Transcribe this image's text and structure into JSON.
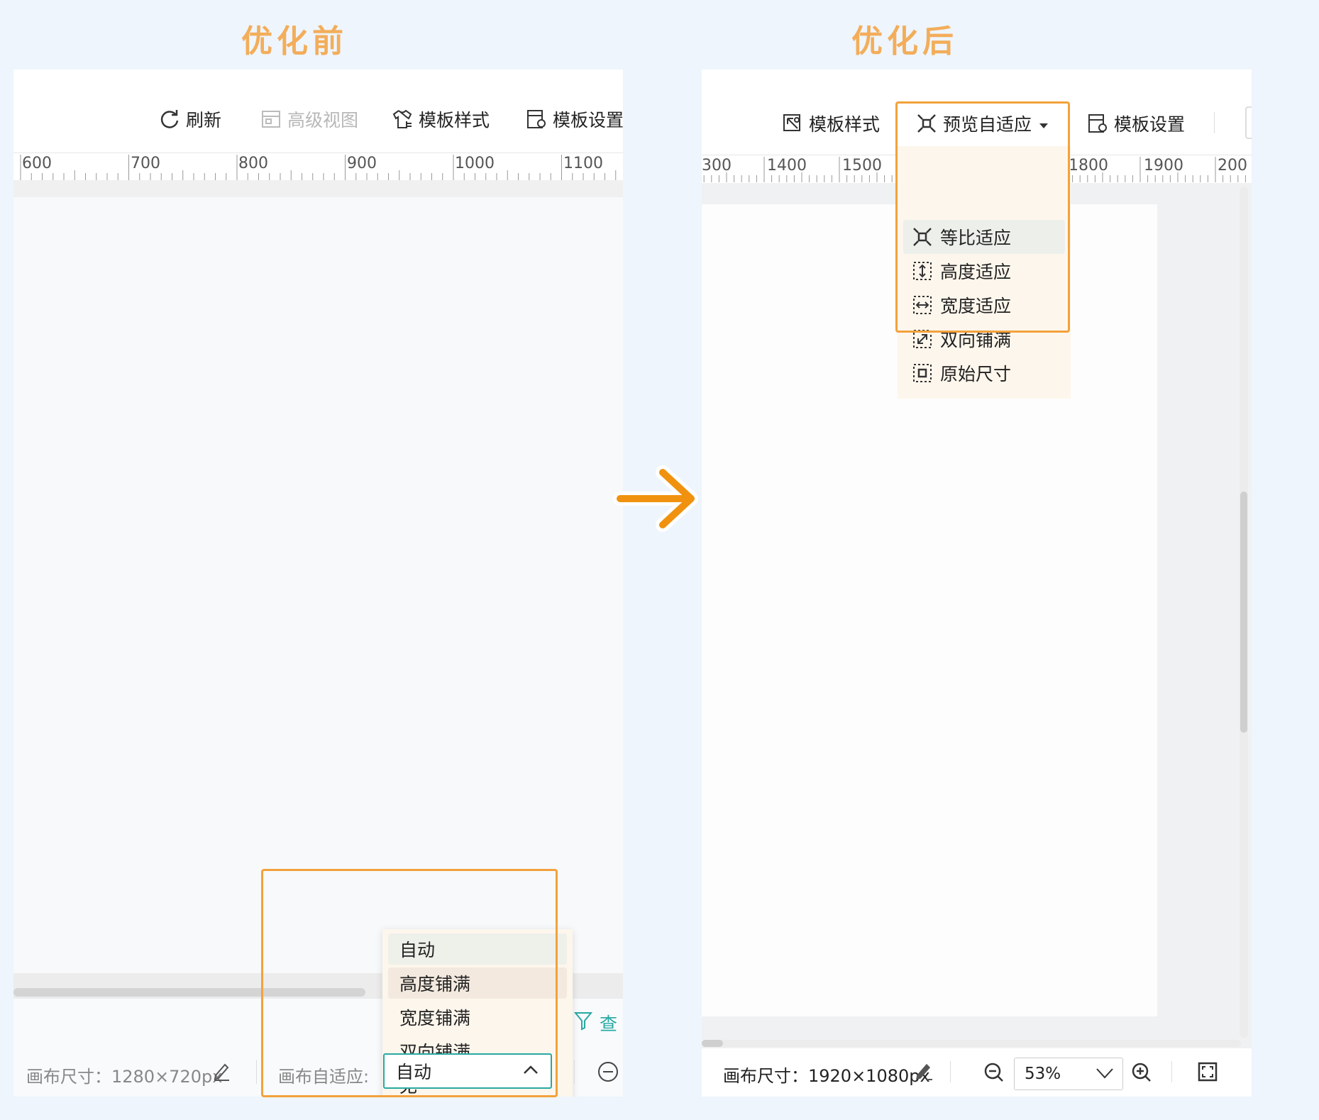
{
  "headings": {
    "before": "优化前",
    "after": "优化后"
  },
  "left": {
    "toolbar": {
      "refresh": "刷新",
      "advanced_view": "高级视图",
      "template_style": "模板样式",
      "template_settings": "模板设置"
    },
    "ruler": [
      "600",
      "700",
      "800",
      "900",
      "1000",
      "1100"
    ],
    "status": {
      "canvas_size": "画布尺寸：1280×720px",
      "adapt_label": "画布自适应:",
      "adapt_value": "自动",
      "query_label": "查"
    },
    "adapt_options": [
      "自动",
      "高度铺满",
      "宽度铺满",
      "双向铺满",
      "无"
    ],
    "hovered_option": "高度铺满"
  },
  "right": {
    "toolbar": {
      "template_style": "模板样式",
      "preview_adapt": "预览自适应",
      "template_settings": "模板设置"
    },
    "ruler": [
      "300",
      "1400",
      "1500",
      "1800",
      "1900",
      "200"
    ],
    "adapt_options": [
      {
        "label": "等比适应",
        "icon": "fit-ratio-icon"
      },
      {
        "label": "高度适应",
        "icon": "fit-height-icon"
      },
      {
        "label": "宽度适应",
        "icon": "fit-width-icon"
      },
      {
        "label": "双向铺满",
        "icon": "fill-both-icon"
      },
      {
        "label": "原始尺寸",
        "icon": "original-size-icon"
      }
    ],
    "selected_option": "等比适应",
    "status": {
      "canvas_size": "画布尺寸：1920×1080px",
      "zoom": "53%"
    }
  },
  "colors": {
    "highlight": "#f2a23c",
    "arrow": "#f0920f",
    "heading": "#f3ad5a",
    "teal": "#28a9a2"
  }
}
